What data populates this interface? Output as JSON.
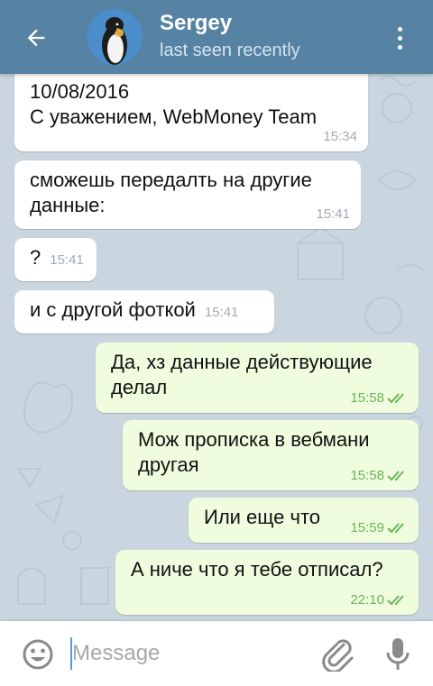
{
  "header": {
    "title": "Sergey",
    "subtitle": "last seen recently",
    "back_icon": "arrow-left-icon",
    "menu_icon": "more-vertical-icon",
    "background": "#5682a3"
  },
  "messages": [
    {
      "direction": "in",
      "text": "10/08/2016\nС уважением, WebMoney Team",
      "time": "15:34"
    },
    {
      "direction": "in",
      "text": "сможешь передалть на другие\nданные:",
      "time": "15:41"
    },
    {
      "direction": "in",
      "text": "?",
      "time": "15:41"
    },
    {
      "direction": "in",
      "text": "и с другой фоткой",
      "time": "15:41"
    },
    {
      "direction": "out",
      "text": "Да, хз данные действующие\nделал",
      "time": "15:58",
      "status": "read"
    },
    {
      "direction": "out",
      "text": "Мож прописка в вебмани\nдругая",
      "time": "15:58",
      "status": "read"
    },
    {
      "direction": "out",
      "text": "Или еще что",
      "time": "15:59",
      "status": "read"
    },
    {
      "direction": "out",
      "text": "А ниче что я тебе отписал?",
      "time": "22:10",
      "status": "read"
    }
  ],
  "composer": {
    "placeholder": "Message",
    "emoji_icon": "emoji-icon",
    "attach_icon": "paperclip-icon",
    "mic_icon": "microphone-icon"
  },
  "colors": {
    "incoming_bubble": "#ffffff",
    "outgoing_bubble": "#effdde",
    "outgoing_time": "#6cb55a",
    "wallpaper": "#c9d6df"
  }
}
